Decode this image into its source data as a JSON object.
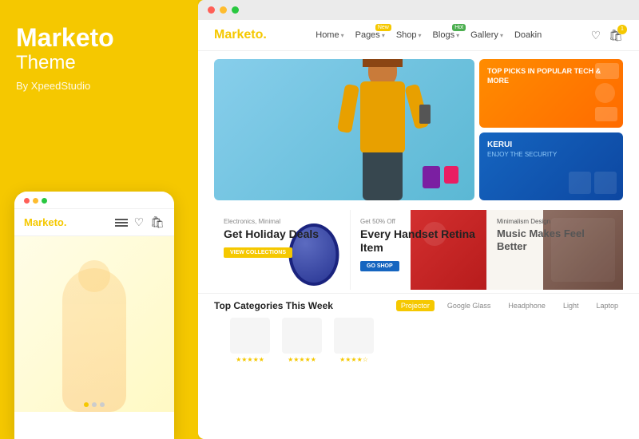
{
  "app": {
    "bg_color": "#F5C800"
  },
  "left": {
    "brand": "Marketo",
    "theme": "Theme",
    "by": "By XpeedStudio"
  },
  "mobile": {
    "logo": "Marketo",
    "logo_dot": ".",
    "dots": [
      "red",
      "yellow",
      "green"
    ]
  },
  "browser": {
    "dots": [
      "r",
      "y",
      "g"
    ]
  },
  "header": {
    "logo": "Marketo",
    "logo_dot": ".",
    "nav": [
      {
        "label": "Home",
        "arrow": true,
        "badge": null
      },
      {
        "label": "Pages",
        "arrow": true,
        "badge": "New"
      },
      {
        "label": "Shop",
        "arrow": true,
        "badge": null
      },
      {
        "label": "Blogs",
        "arrow": true,
        "badge": "Hot"
      },
      {
        "label": "Gallery",
        "arrow": true,
        "badge": null
      },
      {
        "label": "Doakin",
        "arrow": false,
        "badge": null
      }
    ]
  },
  "hero": {
    "side_top_label": "TOP PICKS IN POPULAR TECH & MORE",
    "side_bottom_label": "KERUI",
    "side_bottom_sub": "ENJOY THE SECURITY"
  },
  "promos": [
    {
      "tag": "Electronics, Minimal",
      "title": "Get Holiday Deals",
      "btn": "VIEW COLLECTIONS",
      "btn_color": "yellow"
    },
    {
      "tag": "Get 50% Off",
      "title": "Every Handset Retina Item",
      "btn": "GO SHOP",
      "btn_color": "blue"
    },
    {
      "tag": "Minimalism Design",
      "title": "Music Makes Feel Better",
      "btn": null,
      "btn_color": null
    }
  ],
  "categories": {
    "title": "Top Categories This Week",
    "tabs": [
      "Projector",
      "Google Glass",
      "Headphone",
      "Light",
      "Laptop"
    ]
  },
  "colors": {
    "accent": "#F5C800",
    "brand": "#F5C800"
  }
}
